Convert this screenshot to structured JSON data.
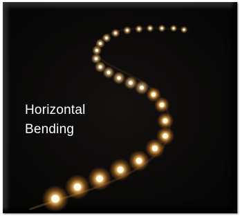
{
  "image": {
    "caption_line1": "Horizontal",
    "caption_line2": "Bending",
    "subject": "bent LED light strip",
    "colors": {
      "background": "#0a0908",
      "led_core": "#fffbe8",
      "led_glow": "#ffb24a",
      "caption": "#ffffff"
    }
  }
}
